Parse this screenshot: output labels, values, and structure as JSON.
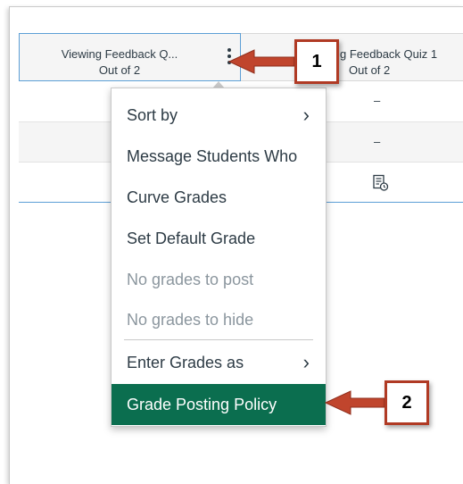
{
  "columns": [
    {
      "title": "Viewing Feedback Q...",
      "subtitle": "Out of 2"
    },
    {
      "title": "g Feedback Quiz 1",
      "subtitle": "Out of 2"
    }
  ],
  "rows": [
    {
      "col2": "–"
    },
    {
      "col2": "–"
    },
    {
      "col2_icon": "document-clock-icon"
    }
  ],
  "menu": {
    "items": [
      {
        "label": "Sort by",
        "has_submenu": true,
        "enabled": true
      },
      {
        "label": "Message Students Who",
        "has_submenu": false,
        "enabled": true
      },
      {
        "label": "Curve Grades",
        "has_submenu": false,
        "enabled": true
      },
      {
        "label": "Set Default Grade",
        "has_submenu": false,
        "enabled": true
      },
      {
        "label": "No grades to post",
        "has_submenu": false,
        "enabled": false
      },
      {
        "label": "No grades to hide",
        "has_submenu": false,
        "enabled": false
      },
      {
        "label": "Enter Grades as",
        "has_submenu": true,
        "enabled": true
      },
      {
        "label": "Grade Posting Policy",
        "has_submenu": false,
        "enabled": true,
        "highlighted": true
      }
    ],
    "chevron": "›"
  },
  "callouts": [
    {
      "number": "1"
    },
    {
      "number": "2"
    }
  ],
  "colors": {
    "highlight": "#0b6e4f",
    "callout_border": "#b03a24",
    "arrow": "#c0452d",
    "selected_border": "#5c9fd6"
  }
}
